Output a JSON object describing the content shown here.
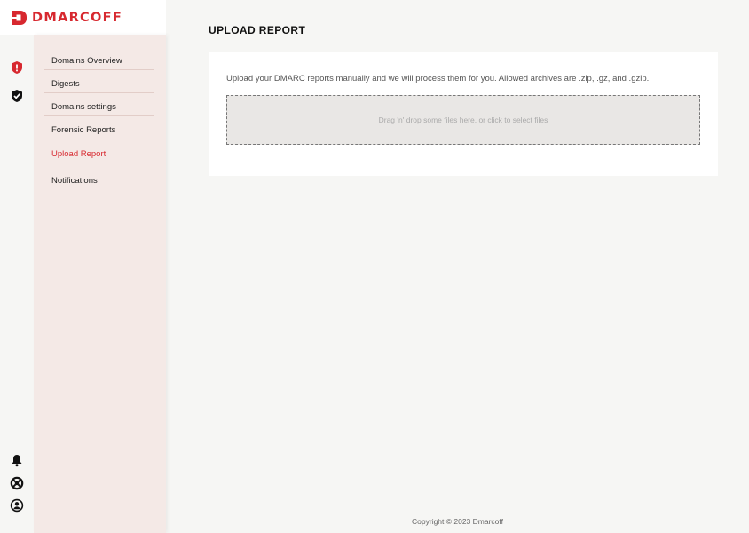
{
  "brand": {
    "name": "DMARCOFF",
    "color": "#d7282f"
  },
  "icon_rail": {
    "top": [
      {
        "icon": "shield-alert-icon",
        "color": "#d7282f"
      },
      {
        "icon": "shield-check-icon",
        "color": "#111111"
      }
    ],
    "bottom": [
      {
        "icon": "bell-icon"
      },
      {
        "icon": "lifebuoy-icon"
      },
      {
        "icon": "user-circle-icon"
      }
    ]
  },
  "sidebar": {
    "items": [
      {
        "label": "Domains Overview"
      },
      {
        "label": "Digests"
      },
      {
        "label": "Domains settings"
      },
      {
        "label": "Forensic Reports"
      },
      {
        "label": "Upload Report",
        "active": true
      },
      {
        "label": "Notifications"
      }
    ]
  },
  "page": {
    "title": "UPLOAD REPORT",
    "description": "Upload your DMARC reports manually and we will process them for you. Allowed archives are .zip, .gz, and .gzip.",
    "dropzone_text": "Drag 'n' drop some files here, or click to select files"
  },
  "footer": {
    "copyright": "Copyright © 2023 Dmarcoff"
  }
}
